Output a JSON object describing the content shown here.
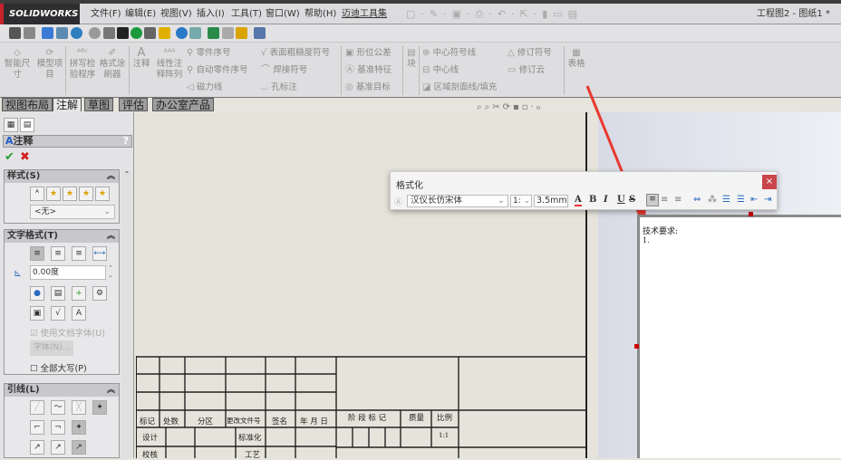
{
  "app": {
    "logo": "SOLIDWORKS",
    "document_title": "工程图2 - 图纸1 *"
  },
  "menu": [
    "文件(F)",
    "编辑(E)",
    "视图(V)",
    "插入(I)",
    "工具(T)",
    "窗口(W)",
    "帮助(H)",
    "迈迪工具集"
  ],
  "ribbon": {
    "smart_dim": "智能尺寸",
    "model_items": "模型项目",
    "spell_check": "拼写检验程序",
    "format_painter": "格式涂刷器",
    "note": "注释",
    "linear_pattern": "线性注释阵列",
    "balloon": "零件序号",
    "auto_balloon": "自动零件序号",
    "magnetic_line": "磁力线",
    "surface_finish": "表面粗糙度符号",
    "weld_symbol": "焊接符号",
    "hole_callout": "孔标注",
    "gtol": "形位公差",
    "datum_feature": "基准特征",
    "datum_target": "基准目标",
    "block": "块",
    "center_mark": "中心符号线",
    "centerline": "中心线",
    "area_hatch": "区域剖面线/填充",
    "revision_symbol": "修订符号",
    "revision_cloud": "修订云",
    "table": "表格"
  },
  "tabs": [
    "视图布局",
    "注解",
    "草图",
    "评估",
    "办公室产品"
  ],
  "panel": {
    "title": "注释",
    "help": "?",
    "style_header": "样式(S)",
    "style_value": "<无>",
    "text_format_header": "文字格式(T)",
    "angle_value": "0.00度",
    "use_doc_font": "使用文档字体(U)",
    "font_button": "字体(N)...",
    "all_caps": "全部大写(P)",
    "leader_header": "引线(L)"
  },
  "format_dialog": {
    "title": "格式化",
    "font": "汉仪长仿宋体",
    "size_option": "1:",
    "height": "3.5mm",
    "close": "×",
    "bold": "B",
    "italic": "I",
    "underline": "U",
    "strike": "S",
    "color": "A"
  },
  "note_text": {
    "line1": "技术要求:",
    "line2": "1."
  },
  "title_block": {
    "h1": "标记",
    "h2": "处数",
    "h3": "分区",
    "h4": "更改文件号",
    "h5": "签名",
    "h6": "年 月 日",
    "stage": "阶 段 标 记",
    "mass": "质量",
    "scale": "比例",
    "scale_value": "1:1",
    "design": "设计",
    "standard": "标准化",
    "check": "校核",
    "process": "工艺"
  }
}
